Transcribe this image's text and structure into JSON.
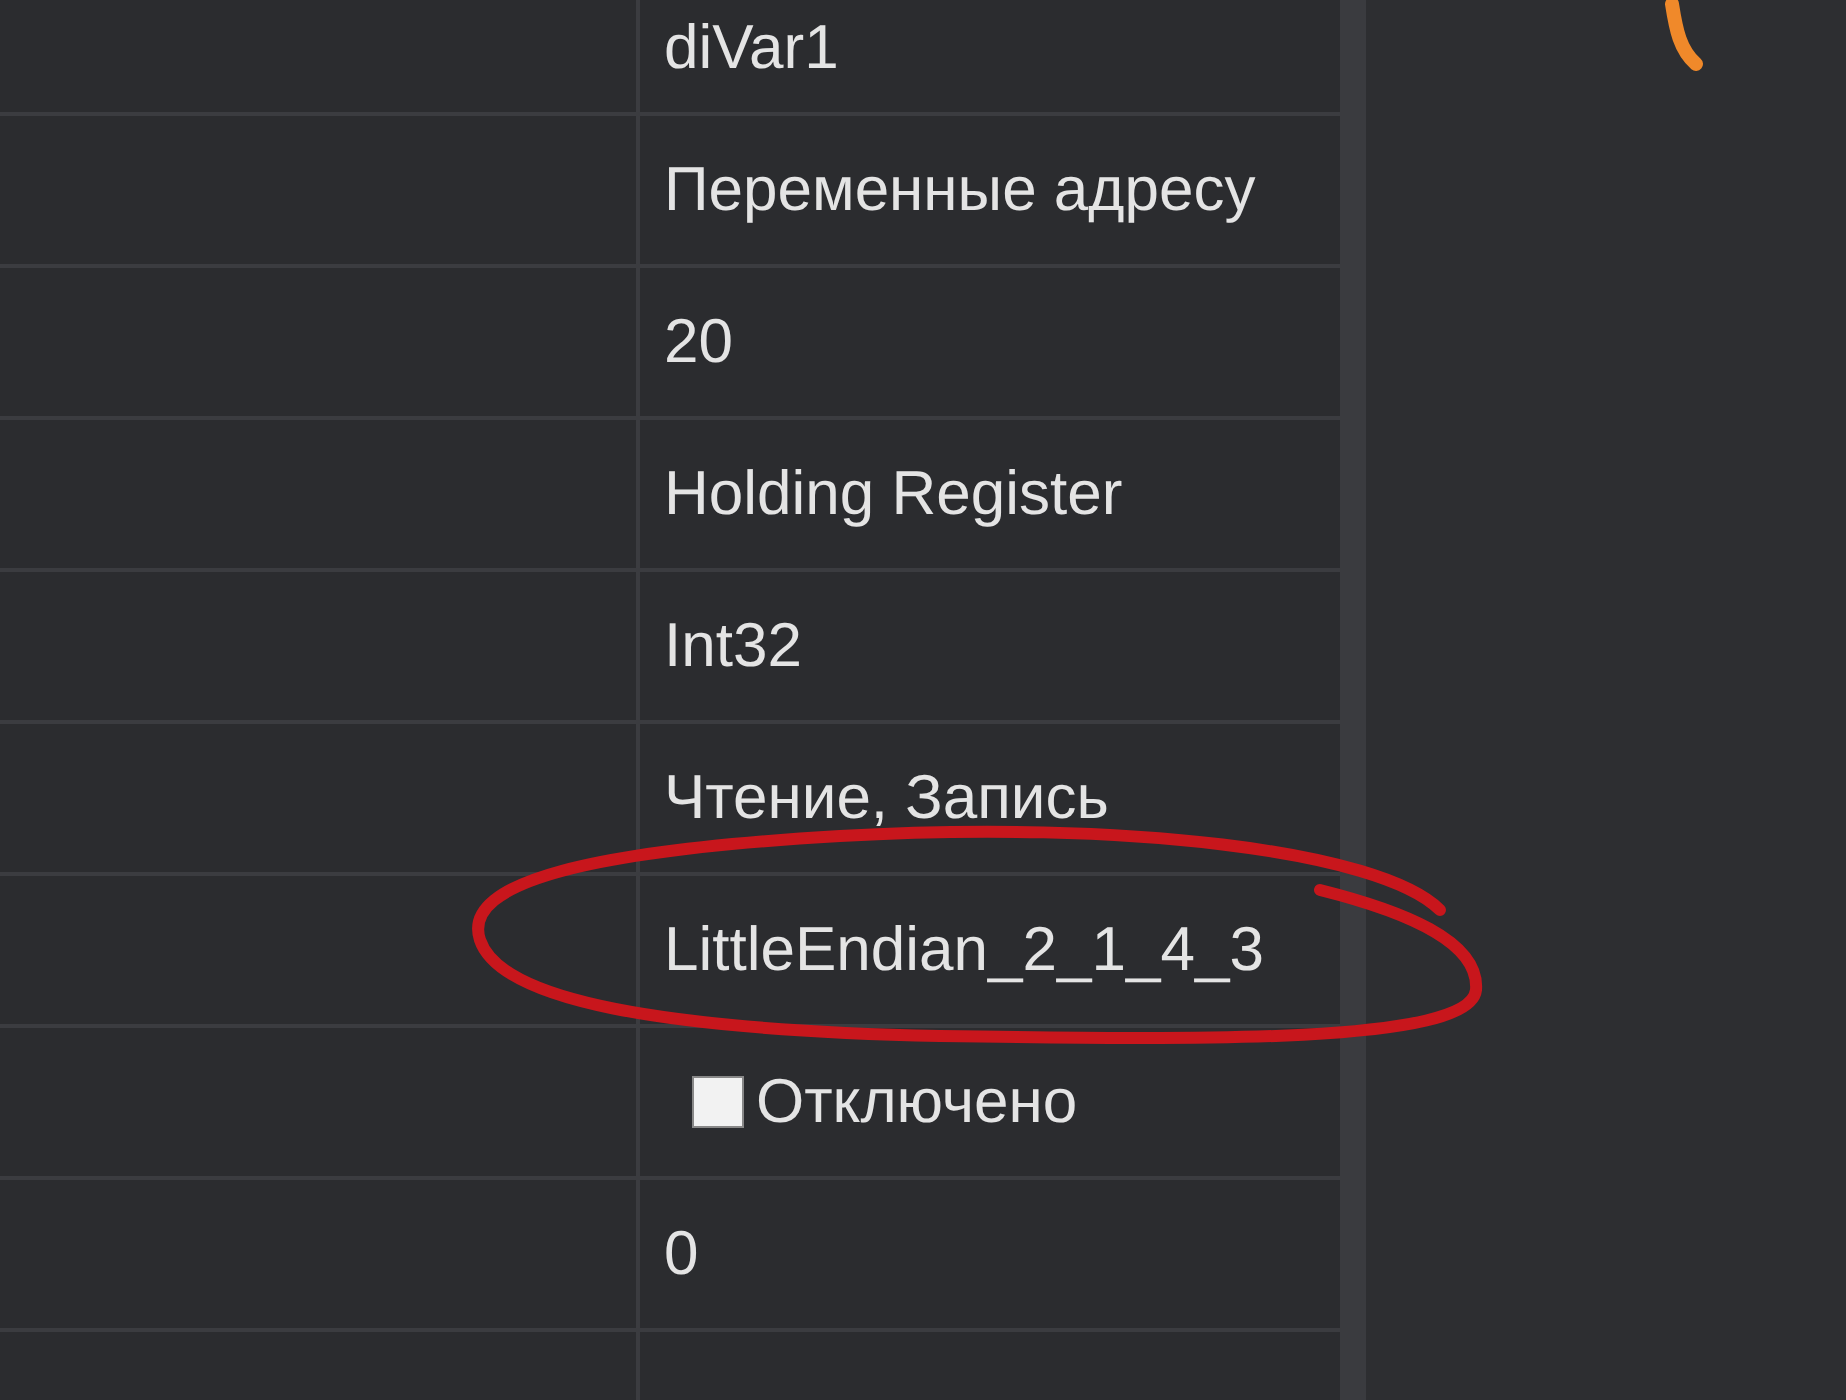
{
  "rows": [
    {
      "kind": "text",
      "value": "diVar1"
    },
    {
      "kind": "text",
      "value": "Переменные адресу"
    },
    {
      "kind": "text",
      "value": "20"
    },
    {
      "kind": "text",
      "value": "Holding Register"
    },
    {
      "kind": "text",
      "value": "Int32"
    },
    {
      "kind": "text",
      "value": "Чтение, Запись"
    },
    {
      "kind": "text",
      "value": "LittleEndian_2_1_4_3"
    },
    {
      "kind": "checkbox",
      "checked": false,
      "value": "Отключено"
    },
    {
      "kind": "text",
      "value": "0"
    }
  ]
}
